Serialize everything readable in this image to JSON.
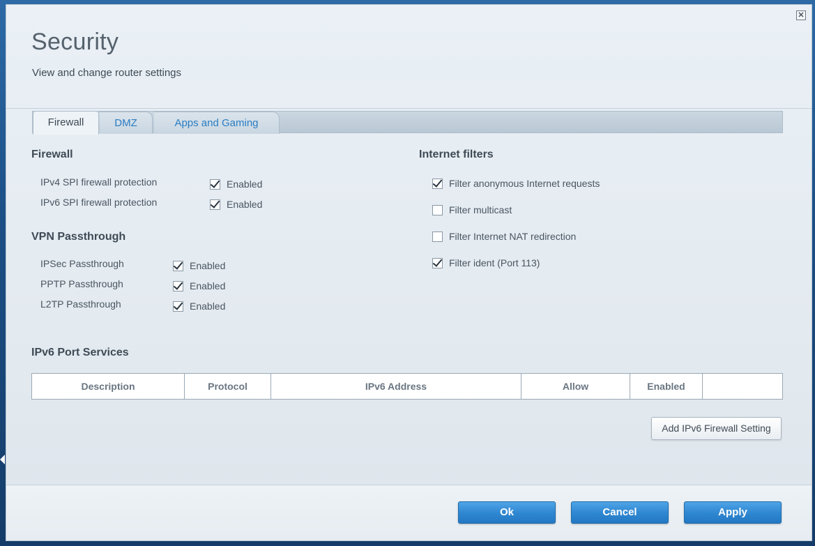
{
  "header": {
    "title": "Security",
    "subtitle": "View and change router settings",
    "close_icon": "close-icon"
  },
  "tabs": [
    {
      "label": "Firewall",
      "active": true
    },
    {
      "label": "DMZ",
      "active": false
    },
    {
      "label": "Apps and Gaming",
      "active": false
    }
  ],
  "firewall": {
    "title": "Firewall",
    "rows": [
      {
        "label": "IPv4 SPI firewall protection",
        "option": "Enabled",
        "checked": true
      },
      {
        "label": "IPv6 SPI firewall protection",
        "option": "Enabled",
        "checked": true
      }
    ]
  },
  "vpn": {
    "title": "VPN Passthrough",
    "rows": [
      {
        "label": "IPSec Passthrough",
        "option": "Enabled",
        "checked": true
      },
      {
        "label": "PPTP Passthrough",
        "option": "Enabled",
        "checked": true
      },
      {
        "label": "L2TP Passthrough",
        "option": "Enabled",
        "checked": true
      }
    ]
  },
  "internet_filters": {
    "title": "Internet filters",
    "rows": [
      {
        "label": "Filter anonymous Internet requests",
        "checked": true
      },
      {
        "label": "Filter multicast",
        "checked": false
      },
      {
        "label": "Filter Internet NAT redirection",
        "checked": false
      },
      {
        "label": "Filter ident (Port 113)",
        "checked": true
      }
    ]
  },
  "ipv6_services": {
    "title": "IPv6 Port Services",
    "columns": [
      "Description",
      "Protocol",
      "IPv6 Address",
      "Allow",
      "Enabled",
      ""
    ],
    "add_button": "Add IPv6 Firewall Setting"
  },
  "footer": {
    "ok": "Ok",
    "cancel": "Cancel",
    "apply": "Apply"
  },
  "colors": {
    "accent": "#2e86d1",
    "tab_link": "#2a7cc2",
    "text": "#3f4a55"
  }
}
